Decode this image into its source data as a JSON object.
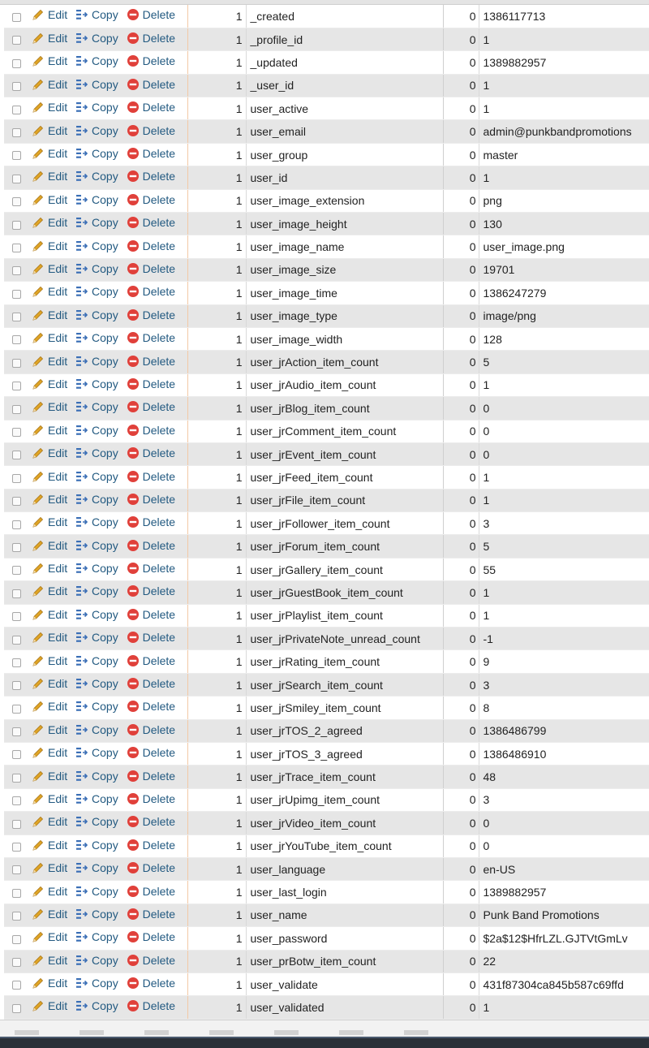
{
  "actions": {
    "edit": "Edit",
    "copy": "Copy",
    "delete": "Delete"
  },
  "colors": {
    "link": "#235a81",
    "pencil": "#e0a526",
    "copy_icon": "#3b6fb6",
    "delete_icon": "#e0403a"
  },
  "rows": [
    {
      "num": "1",
      "key": "_created",
      "flag": "0",
      "value": "1386117713"
    },
    {
      "num": "1",
      "key": "_profile_id",
      "flag": "0",
      "value": "1"
    },
    {
      "num": "1",
      "key": "_updated",
      "flag": "0",
      "value": "1389882957"
    },
    {
      "num": "1",
      "key": "_user_id",
      "flag": "0",
      "value": "1"
    },
    {
      "num": "1",
      "key": "user_active",
      "flag": "0",
      "value": "1"
    },
    {
      "num": "1",
      "key": "user_email",
      "flag": "0",
      "value": "admin@punkbandpromotions"
    },
    {
      "num": "1",
      "key": "user_group",
      "flag": "0",
      "value": "master"
    },
    {
      "num": "1",
      "key": "user_id",
      "flag": "0",
      "value": "1"
    },
    {
      "num": "1",
      "key": "user_image_extension",
      "flag": "0",
      "value": "png"
    },
    {
      "num": "1",
      "key": "user_image_height",
      "flag": "0",
      "value": "130"
    },
    {
      "num": "1",
      "key": "user_image_name",
      "flag": "0",
      "value": "user_image.png"
    },
    {
      "num": "1",
      "key": "user_image_size",
      "flag": "0",
      "value": "19701"
    },
    {
      "num": "1",
      "key": "user_image_time",
      "flag": "0",
      "value": "1386247279"
    },
    {
      "num": "1",
      "key": "user_image_type",
      "flag": "0",
      "value": "image/png"
    },
    {
      "num": "1",
      "key": "user_image_width",
      "flag": "0",
      "value": "128"
    },
    {
      "num": "1",
      "key": "user_jrAction_item_count",
      "flag": "0",
      "value": "5"
    },
    {
      "num": "1",
      "key": "user_jrAudio_item_count",
      "flag": "0",
      "value": "1"
    },
    {
      "num": "1",
      "key": "user_jrBlog_item_count",
      "flag": "0",
      "value": "0"
    },
    {
      "num": "1",
      "key": "user_jrComment_item_count",
      "flag": "0",
      "value": "0"
    },
    {
      "num": "1",
      "key": "user_jrEvent_item_count",
      "flag": "0",
      "value": "0"
    },
    {
      "num": "1",
      "key": "user_jrFeed_item_count",
      "flag": "0",
      "value": "1"
    },
    {
      "num": "1",
      "key": "user_jrFile_item_count",
      "flag": "0",
      "value": "1"
    },
    {
      "num": "1",
      "key": "user_jrFollower_item_count",
      "flag": "0",
      "value": "3"
    },
    {
      "num": "1",
      "key": "user_jrForum_item_count",
      "flag": "0",
      "value": "5"
    },
    {
      "num": "1",
      "key": "user_jrGallery_item_count",
      "flag": "0",
      "value": "55"
    },
    {
      "num": "1",
      "key": "user_jrGuestBook_item_count",
      "flag": "0",
      "value": "1"
    },
    {
      "num": "1",
      "key": "user_jrPlaylist_item_count",
      "flag": "0",
      "value": "1"
    },
    {
      "num": "1",
      "key": "user_jrPrivateNote_unread_count",
      "flag": "0",
      "value": "-1"
    },
    {
      "num": "1",
      "key": "user_jrRating_item_count",
      "flag": "0",
      "value": "9"
    },
    {
      "num": "1",
      "key": "user_jrSearch_item_count",
      "flag": "0",
      "value": "3"
    },
    {
      "num": "1",
      "key": "user_jrSmiley_item_count",
      "flag": "0",
      "value": "8"
    },
    {
      "num": "1",
      "key": "user_jrTOS_2_agreed",
      "flag": "0",
      "value": "1386486799"
    },
    {
      "num": "1",
      "key": "user_jrTOS_3_agreed",
      "flag": "0",
      "value": "1386486910"
    },
    {
      "num": "1",
      "key": "user_jrTrace_item_count",
      "flag": "0",
      "value": "48"
    },
    {
      "num": "1",
      "key": "user_jrUpimg_item_count",
      "flag": "0",
      "value": "3"
    },
    {
      "num": "1",
      "key": "user_jrVideo_item_count",
      "flag": "0",
      "value": "0"
    },
    {
      "num": "1",
      "key": "user_jrYouTube_item_count",
      "flag": "0",
      "value": "0"
    },
    {
      "num": "1",
      "key": "user_language",
      "flag": "0",
      "value": "en-US"
    },
    {
      "num": "1",
      "key": "user_last_login",
      "flag": "0",
      "value": "1389882957"
    },
    {
      "num": "1",
      "key": "user_name",
      "flag": "0",
      "value": "Punk Band Promotions"
    },
    {
      "num": "1",
      "key": "user_password",
      "flag": "0",
      "value": "$2a$12$HfrLZL.GJTVtGmLv"
    },
    {
      "num": "1",
      "key": "user_prBotw_item_count",
      "flag": "0",
      "value": "22"
    },
    {
      "num": "1",
      "key": "user_validate",
      "flag": "0",
      "value": "431f87304ca845b587c69ffd"
    },
    {
      "num": "1",
      "key": "user_validated",
      "flag": "0",
      "value": "1"
    }
  ]
}
